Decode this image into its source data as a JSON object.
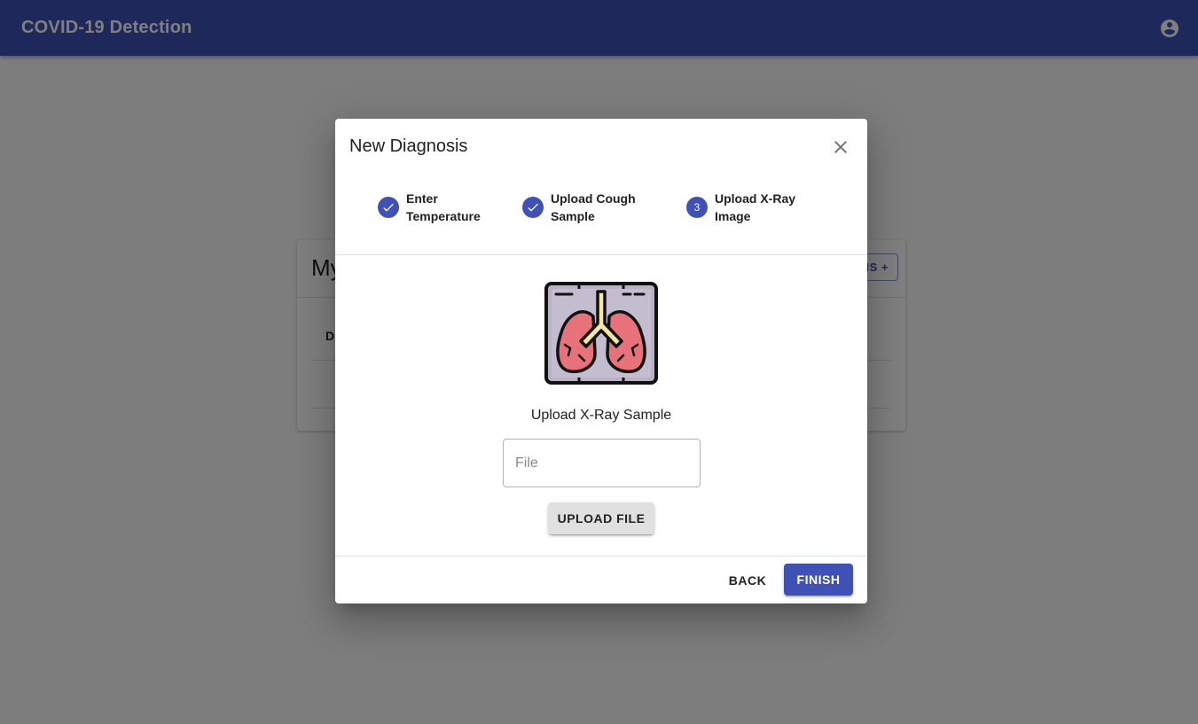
{
  "appbar": {
    "title": "COVID-19 Detection",
    "account_icon": "account-circle-icon"
  },
  "background_card": {
    "title_visible": "My",
    "button_visible": "IS +",
    "table_header_visible": "D"
  },
  "dialog": {
    "title": "New Diagnosis",
    "close_icon": "close-icon",
    "steps": [
      {
        "label": "Enter Temperature",
        "status": "completed",
        "icon": "check-icon"
      },
      {
        "label": "Upload Cough Sample",
        "status": "completed",
        "icon": "check-icon"
      },
      {
        "label": "Upload X-Ray Image",
        "status": "active",
        "number": "3"
      }
    ],
    "image_icon": "lungs-xray-icon",
    "upload_label": "Upload X-Ray Sample",
    "file_field": {
      "placeholder": "File",
      "value": ""
    },
    "upload_button_label": "UPLOAD FILE",
    "back_button_label": "BACK",
    "finish_button_label": "FINISH"
  },
  "colors": {
    "primary": "#3f51b5",
    "backdrop": "rgba(0,0,0,0.5)"
  }
}
